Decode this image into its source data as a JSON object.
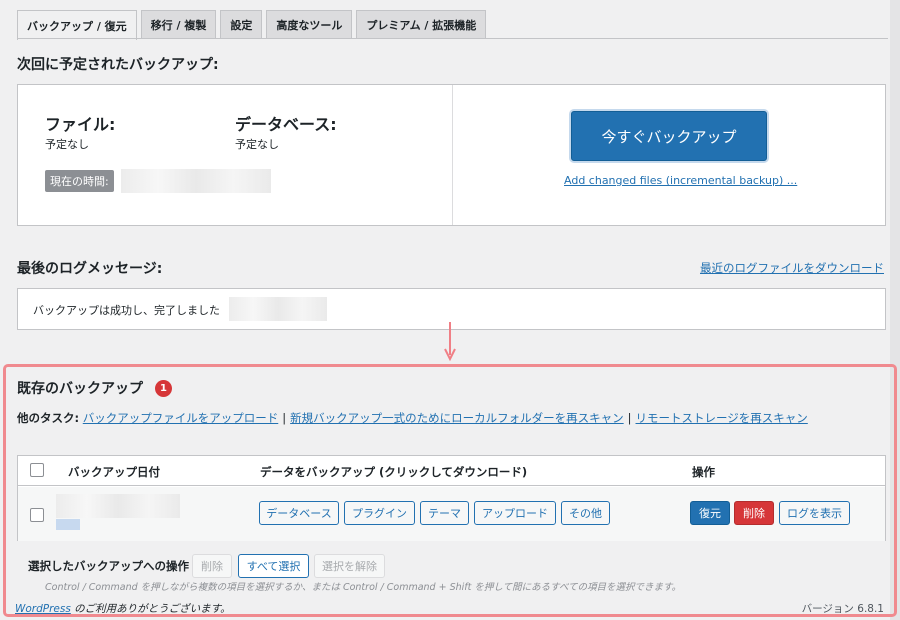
{
  "tabs": [
    {
      "label": "バックアップ / 復元",
      "active": true
    },
    {
      "label": "移行 / 複製",
      "active": false
    },
    {
      "label": "設定",
      "active": false
    },
    {
      "label": "高度なツール",
      "active": false
    },
    {
      "label": "プレミアム / 拡張機能",
      "active": false
    }
  ],
  "next_backup": {
    "title": "次回に予定されたバックアップ:",
    "files_label": "ファイル:",
    "files_value": "予定なし",
    "database_label": "データベース:",
    "database_value": "予定なし",
    "current_time_label": "現在の時間:",
    "backup_now_label": "今すぐバックアップ",
    "incremental_link": "Add changed files (incremental backup) ..."
  },
  "last_log": {
    "title": "最後のログメッセージ:",
    "download_link": "最近のログファイルをダウンロード",
    "message": "バックアップは成功し、完了しました"
  },
  "existing": {
    "title": "既存のバックアップ",
    "count": "1",
    "tasks_label": "他のタスク:",
    "task_links": [
      "バックアップファイルをアップロード",
      "新規バックアップ一式のためにローカルフォルダーを再スキャン",
      "リモートストレージを再スキャン"
    ],
    "separator": "|",
    "columns": {
      "date": "バックアップ日付",
      "data": "データをバックアップ (クリックしてダウンロード)",
      "actions": "操作"
    },
    "data_buttons": [
      "データベース",
      "プラグイン",
      "テーマ",
      "アップロード",
      "その他"
    ],
    "restore_label": "復元",
    "delete_label": "削除",
    "view_log_label": "ログを表示"
  },
  "bulk": {
    "label": "選択したバックアップへの操作",
    "delete_label": "削除",
    "select_all_label": "すべて選択",
    "deselect_label": "選択を解除",
    "hint": "Control / Command を押しながら複数の項目を選択するか、または Control / Command + Shift を押して間にあるすべての項目を選択できます。"
  },
  "footer": {
    "wordpress_link": "WordPress",
    "thanks": " のご利用ありがとうございます。",
    "version": "バージョン 6.8.1"
  },
  "colors": {
    "primary": "#2271b1",
    "delete": "#d63638",
    "highlight_border": "#f08a8f",
    "arrow": "#f07f86"
  }
}
